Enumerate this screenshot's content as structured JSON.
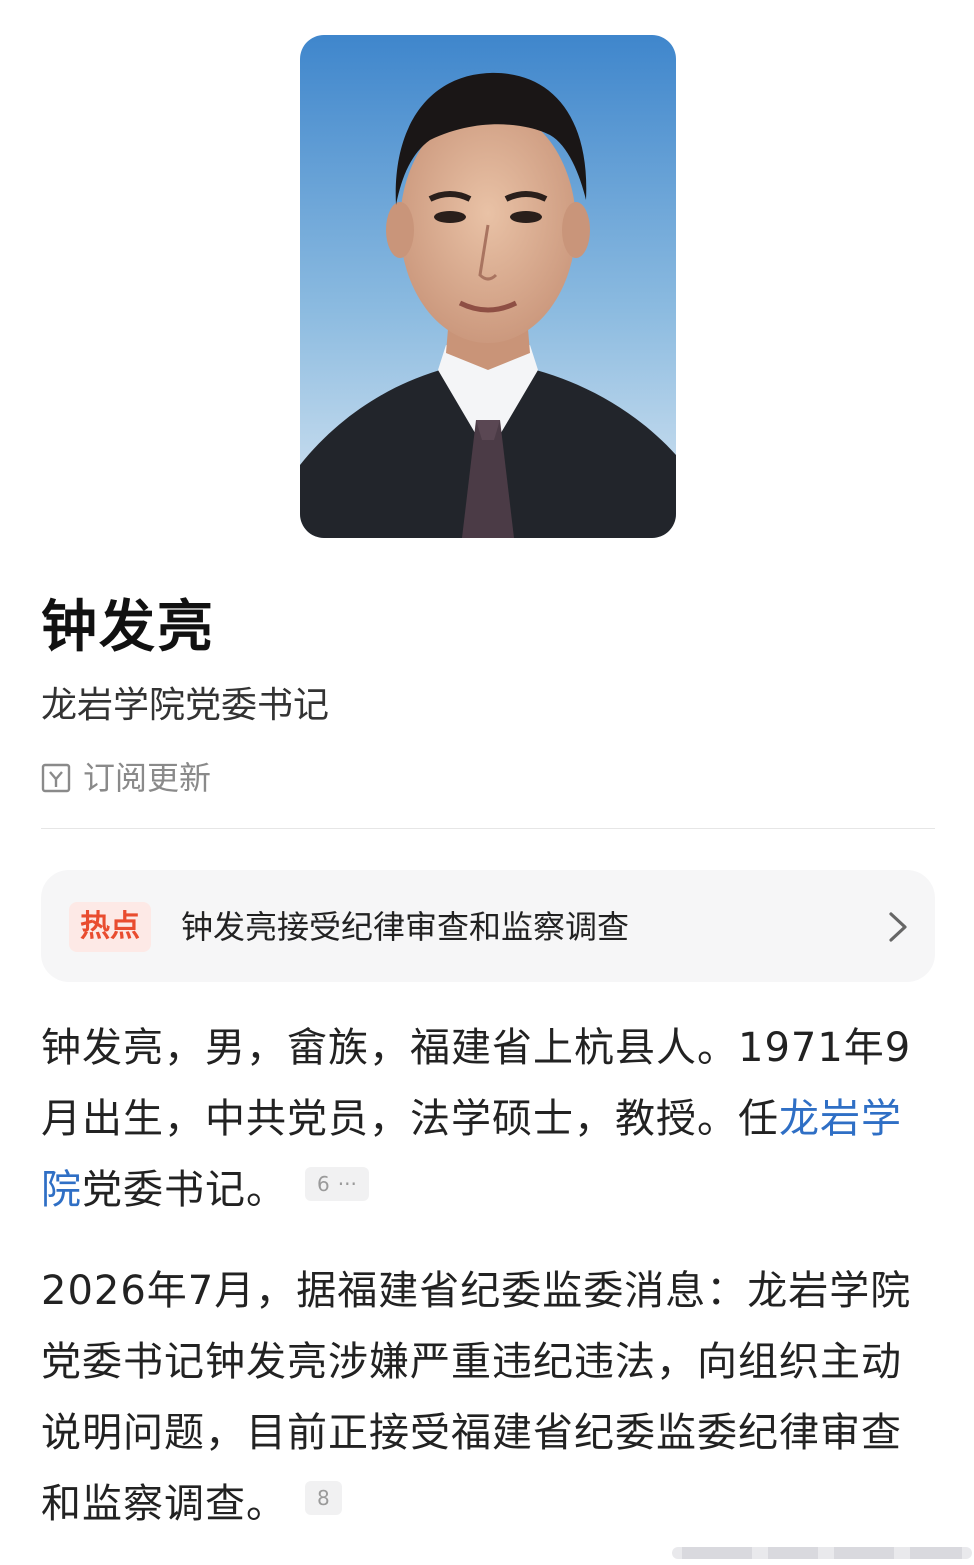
{
  "profile": {
    "name": "钟发亮",
    "title": "龙岩学院党委书记",
    "subscribe_label": "订阅更新"
  },
  "hot": {
    "badge": "热点",
    "headline": "钟发亮接受纪律审查和监察调查"
  },
  "paragraphs": {
    "p1_before_link": "钟发亮，男，畲族，福建省上杭县人。1971年9月出生，中共党员，法学硕士，教授。任",
    "p1_link": "龙岩学院",
    "p1_after_link": "党委书记。",
    "p1_ref": "6",
    "p1_ref_more": "···",
    "p2_text": "2026年7月，据福建省纪委监委消息：龙岩学院党委书记钟发亮涉嫌严重违纪违法，向组织主动说明问题，目前正接受福建省纪委监委纪律审查和监察调查。",
    "p2_ref": "8"
  },
  "colors": {
    "hot_badge_bg": "#fde9e6",
    "hot_badge_text": "#e94c2f",
    "link": "#2f6fc5",
    "card_bg": "#f6f6f7"
  },
  "icons": {
    "subscribe": "subscribe-icon",
    "chevron": "chevron-right-icon"
  }
}
